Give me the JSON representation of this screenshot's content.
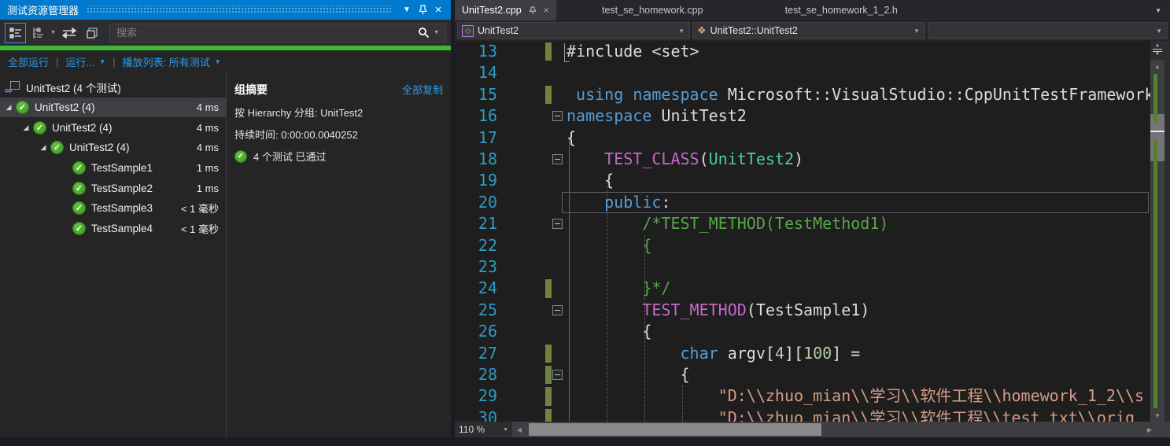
{
  "colors": {
    "titlebar_blue": "#007ACC",
    "progress_green": "#3db834",
    "link_blue": "#2f9ae8",
    "pass_green": "#379a21",
    "keyword_blue": "#569cd6",
    "macro_pink": "#c768c7",
    "type_teal": "#4ec9b0",
    "comment_green": "#57a64a",
    "string_salmon": "#d69d85",
    "change_bar_green": "#70843f"
  },
  "panel": {
    "title": "测试资源管理器",
    "search_placeholder": "搜索",
    "toolbar_icons": [
      "group-by-tree-icon",
      "group-by-hierarchy-icon",
      "run-after-build-icon",
      "layered-windows-icon"
    ],
    "links": {
      "run_all": "全部运行",
      "run": "运行...",
      "playlist": "播放列表: 所有测试"
    },
    "tree": {
      "root": {
        "label": "UnitTest2 (4 个测试)"
      },
      "rows": [
        {
          "label": "UnitTest2 (4)",
          "duration": "4 ms",
          "level": 1,
          "expander": true,
          "selected": true
        },
        {
          "label": "UnitTest2 (4)",
          "duration": "4 ms",
          "level": 2,
          "expander": true,
          "selected": false
        },
        {
          "label": "UnitTest2 (4)",
          "duration": "4 ms",
          "level": 3,
          "expander": true,
          "selected": false
        },
        {
          "label": "TestSample1",
          "duration": "1 ms",
          "level": 4,
          "expander": false,
          "selected": false
        },
        {
          "label": "TestSample2",
          "duration": "1 ms",
          "level": 4,
          "expander": false,
          "selected": false
        },
        {
          "label": "TestSample3",
          "duration": "< 1 毫秒",
          "level": 4,
          "expander": false,
          "selected": false
        },
        {
          "label": "TestSample4",
          "duration": "< 1 毫秒",
          "level": 4,
          "expander": false,
          "selected": false
        }
      ]
    },
    "summary": {
      "title": "组摘要",
      "copy_link": "全部复制",
      "group_line": "按 Hierarchy 分组: UnitTest2",
      "duration_line": "持续时间: 0:00:00.0040252",
      "passed_line": "4 个测试 已通过"
    }
  },
  "editor": {
    "tabs": [
      {
        "label": "UnitTest2.cpp",
        "active": true
      },
      {
        "label": "test_se_homework.cpp",
        "active": false
      },
      {
        "label": "test_se_homework_1_2.h",
        "active": false
      }
    ],
    "nav": {
      "scope": "UnitTest2",
      "member": "UnitTest2::UnitTest2"
    },
    "zoom": "110 %",
    "code": {
      "lines": [
        {
          "n": 13,
          "bar": true,
          "brk": true,
          "tokens": [
            {
              "c": "p",
              "t": "#include <set>"
            }
          ]
        },
        {
          "n": 14,
          "tokens": []
        },
        {
          "n": 15,
          "bar": true,
          "tokens": [
            {
              "c": "p",
              "t": " "
            },
            {
              "c": "k",
              "t": "using"
            },
            {
              "c": "p",
              "t": " "
            },
            {
              "c": "k",
              "t": "namespace"
            },
            {
              "c": "p",
              "t": " Microsoft::VisualStudio::CppUnitTestFramework"
            }
          ]
        },
        {
          "n": 16,
          "fold": true,
          "tokens": [
            {
              "c": "k",
              "t": "namespace"
            },
            {
              "c": "p",
              "t": " UnitTest2"
            }
          ]
        },
        {
          "n": 17,
          "tokens": [
            {
              "c": "p",
              "t": "{"
            }
          ]
        },
        {
          "n": 18,
          "fold": true,
          "tokens": [
            {
              "c": "p",
              "t": "    "
            },
            {
              "c": "m",
              "t": "TEST_CLASS"
            },
            {
              "c": "p",
              "t": "("
            },
            {
              "c": "t",
              "t": "UnitTest2"
            },
            {
              "c": "p",
              "t": ")"
            }
          ]
        },
        {
          "n": 19,
          "tokens": [
            {
              "c": "p",
              "t": "    {"
            }
          ]
        },
        {
          "n": 20,
          "cur": true,
          "tokens": [
            {
              "c": "p",
              "t": "    "
            },
            {
              "c": "k",
              "t": "public"
            },
            {
              "c": "p",
              "t": ":"
            }
          ]
        },
        {
          "n": 21,
          "fold": true,
          "tokens": [
            {
              "c": "c",
              "t": "        /*TEST_METHOD(TestMethod1)"
            }
          ]
        },
        {
          "n": 22,
          "tokens": [
            {
              "c": "c",
              "t": "        {"
            }
          ]
        },
        {
          "n": 23,
          "tokens": []
        },
        {
          "n": 24,
          "bar": true,
          "tokens": [
            {
              "c": "c",
              "t": "        }*/"
            }
          ]
        },
        {
          "n": 25,
          "fold": true,
          "tokens": [
            {
              "c": "p",
              "t": "        "
            },
            {
              "c": "m",
              "t": "TEST_METHOD"
            },
            {
              "c": "p",
              "t": "(TestSample1)"
            }
          ]
        },
        {
          "n": 26,
          "tokens": [
            {
              "c": "p",
              "t": "        {"
            }
          ]
        },
        {
          "n": 27,
          "bar": true,
          "tokens": [
            {
              "c": "p",
              "t": "            "
            },
            {
              "c": "k",
              "t": "char"
            },
            {
              "c": "p",
              "t": " argv["
            },
            {
              "c": "n",
              "t": "4"
            },
            {
              "c": "p",
              "t": "]["
            },
            {
              "c": "n",
              "t": "100"
            },
            {
              "c": "p",
              "t": "] ="
            }
          ]
        },
        {
          "n": 28,
          "fold": true,
          "bar": true,
          "tokens": [
            {
              "c": "p",
              "t": "            {"
            }
          ]
        },
        {
          "n": 29,
          "bar": true,
          "tokens": [
            {
              "c": "s",
              "t": "                \"D:\\\\zhuo_mian\\\\学习\\\\软件工程\\\\homework_1_2\\\\s"
            }
          ]
        },
        {
          "n": 30,
          "bar": true,
          "tokens": [
            {
              "c": "s",
              "t": "                \"D:\\\\zhuo_mian\\\\学习\\\\软件工程\\\\test_txt\\\\orig"
            }
          ]
        }
      ]
    }
  }
}
